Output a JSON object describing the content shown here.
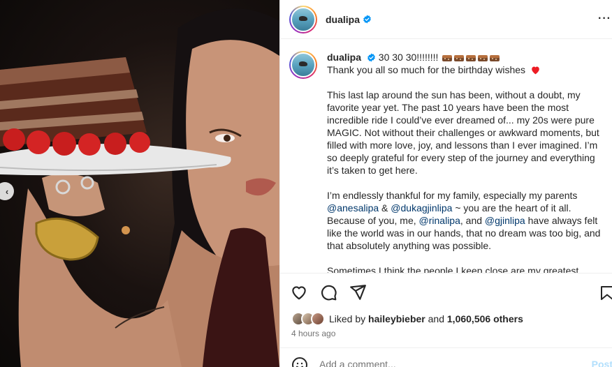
{
  "post": {
    "username": "dualipa",
    "more_icon": "more-horizontal-icon",
    "prev_icon": "chevron-left-icon"
  },
  "caption": {
    "username": "dualipa",
    "line1_text": "30 30 30!!!!!!!!",
    "line2_text": "Thank you all so much for the birthday wishes",
    "para2": "This last lap around the sun has been, without a doubt, my favorite year yet. The past 10 years have been the most incredible ride I could’ve ever dreamed of... my 20s were pure MAGIC. Not without their challenges or awkward moments, but filled with more love, joy, and lessons than I ever imagined. I’m so deeply grateful for every step of the journey and everything it’s taken to get here.",
    "para3_a": "I’m endlessly thankful for my family, especially my parents",
    "mention1": "@anesalipa",
    "amp": "&",
    "mention2": "@dukagjinlipa",
    "para3_b": "~ you are the heart of it all. Because of you, me,",
    "mention3": "@rinalipa",
    "and_word": ", and",
    "mention4": "@gjinlipa",
    "para3_c": "have always felt like the world was in our hands, that no dream was too big, and that absolutely anything was possible.",
    "para4": "Sometimes I think the people I keep close are my greatest"
  },
  "actions": {
    "like_icon": "heart-outline-icon",
    "comment_icon": "comment-bubble-icon",
    "share_icon": "send-icon",
    "save_icon": "bookmark-icon",
    "liked_by_prefix": "Liked by",
    "liked_by_user": "haileybieber",
    "liked_by_and": "and",
    "liked_by_count": "1,060,506 others",
    "timestamp": "4 hours ago"
  },
  "comment": {
    "placeholder": "Add a comment...",
    "post_label": "Post",
    "emoji_icon": "emoji-smile-icon"
  },
  "colors": {
    "link": "#00376b",
    "verified": "#0095f6",
    "post_disabled": "#b2dffc",
    "heart": "#ed1c24"
  }
}
